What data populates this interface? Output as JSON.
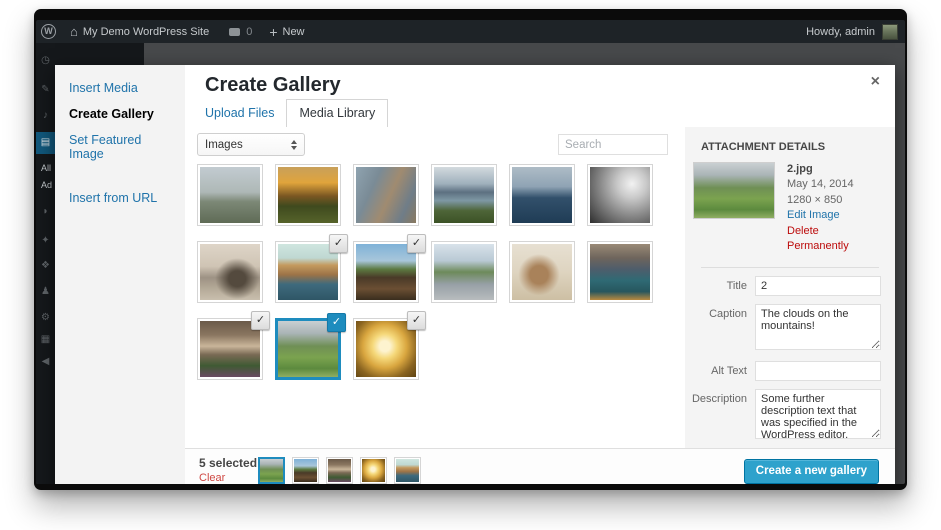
{
  "admin_bar": {
    "logo_letter": "W",
    "site_name": "My Demo WordPress Site",
    "comments_count": "0",
    "new_label": "New",
    "howdy": "Howdy, admin"
  },
  "admin_menu": {
    "items": [
      {
        "type": "icon",
        "name": "dashboard",
        "glyph": "◷"
      },
      {
        "type": "icon",
        "name": "posts",
        "glyph": "✎"
      },
      {
        "type": "icon",
        "name": "media",
        "glyph": "♪"
      },
      {
        "type": "pages",
        "name": "pages",
        "glyph": "▤"
      },
      {
        "type": "text",
        "name": "all-pages",
        "label": "All"
      },
      {
        "type": "text",
        "name": "add-new",
        "label": "Ad"
      },
      {
        "type": "icon",
        "name": "comments",
        "glyph": "◗"
      },
      {
        "type": "icon",
        "name": "appearance",
        "glyph": "✦"
      },
      {
        "type": "icon",
        "name": "plugins",
        "glyph": "❖"
      },
      {
        "type": "icon",
        "name": "users",
        "glyph": "♟"
      },
      {
        "type": "icon",
        "name": "tools",
        "glyph": "⚙"
      },
      {
        "type": "icon",
        "name": "settings",
        "glyph": "▦"
      },
      {
        "type": "icon",
        "name": "collapse",
        "glyph": "◀"
      }
    ]
  },
  "modal": {
    "title": "Create Gallery",
    "close_glyph": "×",
    "menu_items": [
      {
        "label": "Insert Media",
        "active": false
      },
      {
        "label": "Create Gallery",
        "active": true
      },
      {
        "label": "Set Featured Image",
        "active": false
      },
      {
        "label": "Insert from URL",
        "active": false,
        "gap_before": true
      }
    ],
    "tabs": [
      {
        "label": "Upload Files",
        "active": false
      },
      {
        "label": "Media Library",
        "active": true
      }
    ],
    "toolbar": {
      "filter_value": "Images",
      "search_placeholder": "Search"
    },
    "grid_items": [
      {
        "photo": "p1",
        "name": "foggy-meadow",
        "selected": false,
        "focused": false
      },
      {
        "photo": "p2",
        "name": "sunset-pasture",
        "selected": false,
        "focused": false
      },
      {
        "photo": "p3",
        "name": "river-rocks",
        "selected": false,
        "focused": false
      },
      {
        "photo": "p4",
        "name": "lakeside-reeds",
        "selected": false,
        "focused": false
      },
      {
        "photo": "p5",
        "name": "stormy-sea",
        "selected": false,
        "focused": false
      },
      {
        "photo": "p6",
        "name": "city-sunrays",
        "selected": false,
        "focused": false
      },
      {
        "photo": "p7",
        "name": "sea-stack-beach",
        "selected": false,
        "focused": false
      },
      {
        "photo": "p8",
        "name": "canal-houses",
        "selected": true,
        "focused": false
      },
      {
        "photo": "p9",
        "name": "railway-tracks",
        "selected": true,
        "focused": false
      },
      {
        "photo": "p10",
        "name": "mountain-road",
        "selected": false,
        "focused": false
      },
      {
        "photo": "p11",
        "name": "highland-cow",
        "selected": false,
        "focused": false
      },
      {
        "photo": "p12",
        "name": "mountain-lake",
        "selected": false,
        "focused": false
      },
      {
        "photo": "p13",
        "name": "orchard-trees",
        "selected": true,
        "focused": false
      },
      {
        "photo": "p14",
        "name": "green-valley",
        "selected": true,
        "focused": true
      },
      {
        "photo": "p15",
        "name": "golden-field",
        "selected": true,
        "focused": false
      }
    ],
    "check_glyph": "✓",
    "sidebar": {
      "heading": "ATTACHMENT DETAILS",
      "preview_photo": "p14",
      "filename": "2.jpg",
      "date": "May 14, 2014",
      "dimensions": "1280 × 850",
      "edit_link": "Edit Image",
      "delete_link": "Delete Permanently",
      "fields": [
        {
          "label": "Title",
          "type": "input",
          "value": "2",
          "name": "title"
        },
        {
          "label": "Caption",
          "type": "textarea",
          "value": "The clouds on the mountains!",
          "name": "caption"
        },
        {
          "label": "Alt Text",
          "type": "input",
          "value": "",
          "name": "alt-text"
        },
        {
          "label": "Description",
          "type": "textarea",
          "value": "Some further description text that was specified in the WordPress editor.",
          "name": "description"
        }
      ]
    },
    "footer": {
      "selected_count": "5 selected",
      "clear_label": "Clear",
      "selection_thumbs": [
        {
          "photo": "p14",
          "name": "green-valley",
          "focused": true
        },
        {
          "photo": "p9",
          "name": "railway-tracks",
          "focused": false
        },
        {
          "photo": "p13",
          "name": "orchard-trees",
          "focused": false
        },
        {
          "photo": "p15",
          "name": "golden-field",
          "focused": false
        },
        {
          "photo": "p8",
          "name": "canal-houses",
          "focused": false
        }
      ],
      "button_label": "Create a new gallery"
    }
  },
  "colors": {
    "accent_blue": "#1e8cbe",
    "link_blue": "#1f73aa",
    "danger_red": "#bc0b0b",
    "admin_bar_bg": "#1e2327",
    "sidebar_bg": "#f3f3f3"
  }
}
